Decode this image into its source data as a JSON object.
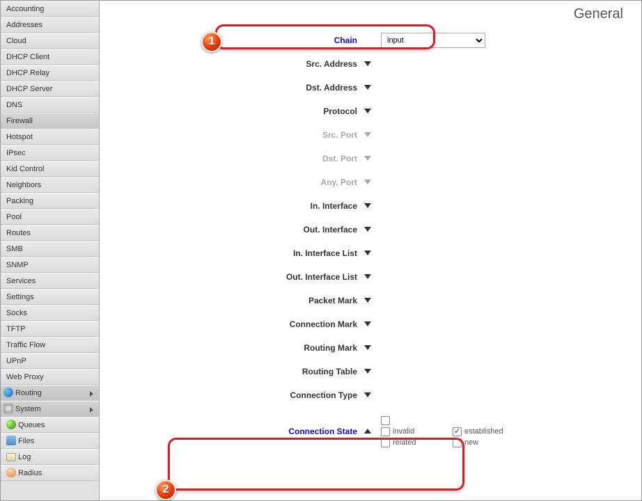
{
  "tab": "General",
  "sidebar": {
    "items": [
      {
        "label": "Accounting",
        "selected": false
      },
      {
        "label": "Addresses",
        "selected": false
      },
      {
        "label": "Cloud",
        "selected": false
      },
      {
        "label": "DHCP Client",
        "selected": false
      },
      {
        "label": "DHCP Relay",
        "selected": false
      },
      {
        "label": "DHCP Server",
        "selected": false
      },
      {
        "label": "DNS",
        "selected": false
      },
      {
        "label": "Firewall",
        "selected": true
      },
      {
        "label": "Hotspot",
        "selected": false
      },
      {
        "label": "IPsec",
        "selected": false
      },
      {
        "label": "Kid Control",
        "selected": false
      },
      {
        "label": "Neighbors",
        "selected": false
      },
      {
        "label": "Packing",
        "selected": false
      },
      {
        "label": "Pool",
        "selected": false
      },
      {
        "label": "Routes",
        "selected": false
      },
      {
        "label": "SMB",
        "selected": false
      },
      {
        "label": "SNMP",
        "selected": false
      },
      {
        "label": "Services",
        "selected": false
      },
      {
        "label": "Settings",
        "selected": false
      },
      {
        "label": "Socks",
        "selected": false
      },
      {
        "label": "TFTP",
        "selected": false
      },
      {
        "label": "Traffic Flow",
        "selected": false
      },
      {
        "label": "UPnP",
        "selected": false
      },
      {
        "label": "Web Proxy",
        "selected": false
      }
    ],
    "parents": [
      {
        "label": "Routing",
        "icon": "ico-route"
      },
      {
        "label": "System",
        "icon": "ico-system"
      },
      {
        "label": "Queues",
        "icon": "ico-queues"
      },
      {
        "label": "Files",
        "icon": "ico-files"
      },
      {
        "label": "Log",
        "icon": "ico-log"
      },
      {
        "label": "Radius",
        "icon": "ico-radius"
      }
    ]
  },
  "form": {
    "chain": {
      "label": "Chain",
      "value": "input",
      "active": true
    },
    "rows": [
      {
        "label": "Src. Address",
        "disabled": false
      },
      {
        "label": "Dst. Address",
        "disabled": false
      },
      {
        "label": "Protocol",
        "disabled": false
      },
      {
        "label": "Src. Port",
        "disabled": true
      },
      {
        "label": "Dst. Port",
        "disabled": true
      },
      {
        "label": "Any. Port",
        "disabled": true
      },
      {
        "label": "In. Interface",
        "disabled": false
      },
      {
        "label": "Out. Interface",
        "disabled": false
      },
      {
        "label": "In. Interface List",
        "disabled": false
      },
      {
        "label": "Out. Interface List",
        "disabled": false
      },
      {
        "label": "Packet Mark",
        "disabled": false
      },
      {
        "label": "Connection Mark",
        "disabled": false
      },
      {
        "label": "Routing Mark",
        "disabled": false
      },
      {
        "label": "Routing Table",
        "disabled": false
      },
      {
        "label": "Connection Type",
        "disabled": false
      }
    ],
    "conn_state": {
      "label": "Connection State",
      "options": {
        "invalid": {
          "label": "invalid",
          "checked": false
        },
        "established": {
          "label": "established",
          "checked": true
        },
        "related": {
          "label": "related",
          "checked": false
        },
        "new": {
          "label": "new",
          "checked": false
        }
      }
    }
  },
  "badges": {
    "b1": "1",
    "b2": "2"
  }
}
